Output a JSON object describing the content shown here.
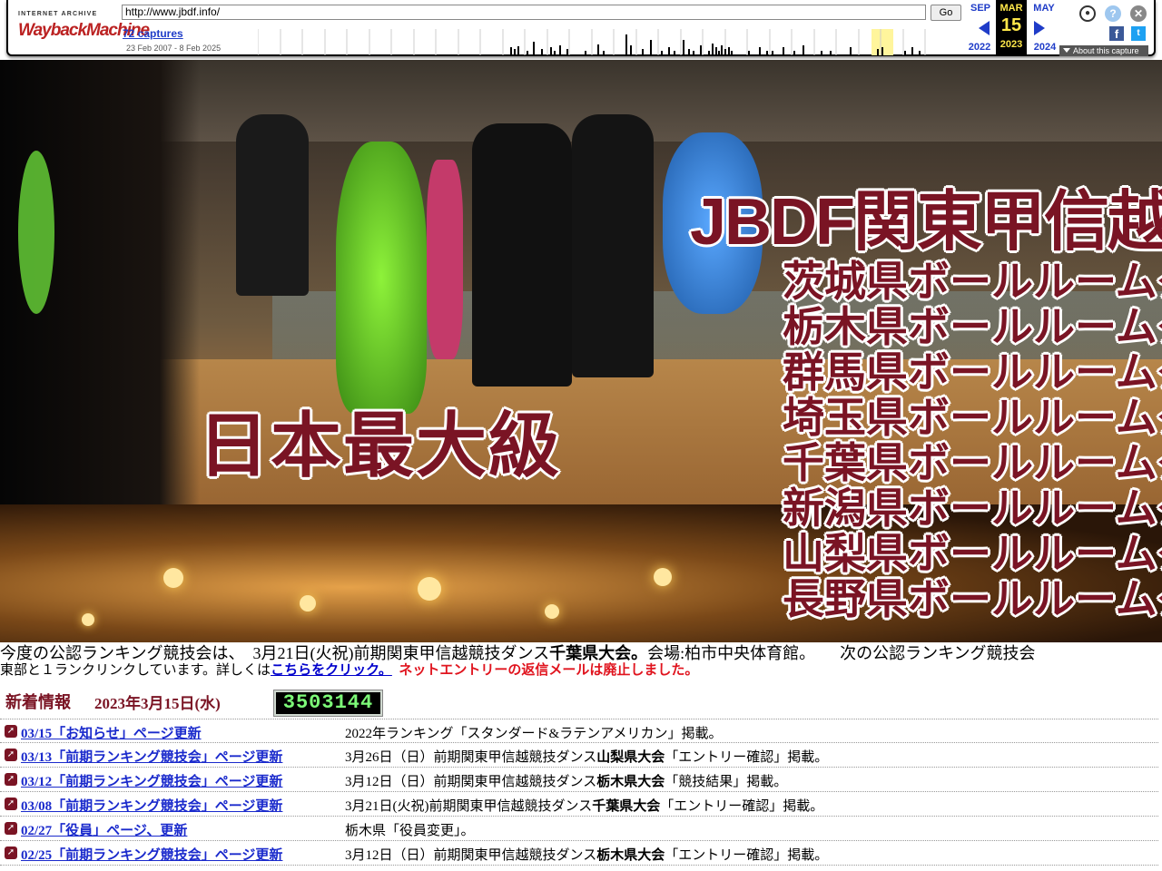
{
  "wayback": {
    "logo_top": "INTERNET ARCHIVE",
    "logo_main": "WaybackMachine",
    "url": "http://www.jbdf.info/",
    "go_label": "Go",
    "captures": "72 captures",
    "range": "23 Feb 2007 - 8 Feb 2025",
    "prev_month": "SEP",
    "prev_year": "2022",
    "cur_month": "MAR",
    "cur_day": "15",
    "cur_year": "2023",
    "next_month": "MAY",
    "next_year": "2024",
    "about": "About this capture",
    "colors": {
      "link": "#1f3cc8",
      "highlight": "#ffe84a"
    }
  },
  "banner": {
    "title": "JBDF関東甲信越",
    "slogan": "日本最大級",
    "prefectures": [
      "茨城県ボールルームダ",
      "栃木県ボールルームダ",
      "群馬県ボールルームダ",
      "埼玉県ボールルームダ",
      "千葉県ボールルームダ",
      "新潟県ボールルームダ",
      "山梨県ボールルームダ",
      "長野県ボールルームダ"
    ],
    "colors": {
      "title": "#7a1424"
    }
  },
  "marquee": {
    "part1": "今度の公認ランキング競技会は、　3月21日(火祝)前期関東甲信越競技ダンス",
    "bold": "千葉県大会。",
    "part2": "会場:柏市中央体育館。　　次の公認ランキング競技会"
  },
  "notice": {
    "text": "東部と１ランクリンクしています。詳しくは",
    "link": "こちらをクリック。",
    "red": "ネットエントリーの返信メールは廃止しました。"
  },
  "news": {
    "heading": "新着情報",
    "date": "2023年3月15日(水)",
    "counter": "3503144",
    "items": [
      {
        "link": "03/15「お知らせ」ページ更新",
        "pre": "2022年ランキング「スタンダード&ラテンアメリカン」掲載。",
        "bold": "",
        "post": ""
      },
      {
        "link": "03/13「前期ランキング競技会」ページ更新",
        "pre": "3月26日（日）前期関東甲信越競技ダンス",
        "bold": "山梨県大会",
        "post": "「エントリー確認」掲載。"
      },
      {
        "link": "03/12「前期ランキング競技会」ページ更新",
        "pre": "3月12日（日）前期関東甲信越競技ダンス",
        "bold": "栃木県大会",
        "post": "「競技結果」掲載。"
      },
      {
        "link": "03/08「前期ランキング競技会」ページ更新",
        "pre": "3月21日(火祝)前期関東甲信越競技ダンス",
        "bold": "千葉県大会",
        "post": "「エントリー確認」掲載。"
      },
      {
        "link": "02/27「役員」ページ、更新",
        "pre": "栃木県「役員変更」。",
        "bold": "",
        "post": ""
      },
      {
        "link": "02/25「前期ランキング競技会」ページ更新",
        "pre": "3月12日（日）前期関東甲信越競技ダンス",
        "bold": "栃木県大会",
        "post": "「エントリー確認」掲載。"
      }
    ]
  }
}
